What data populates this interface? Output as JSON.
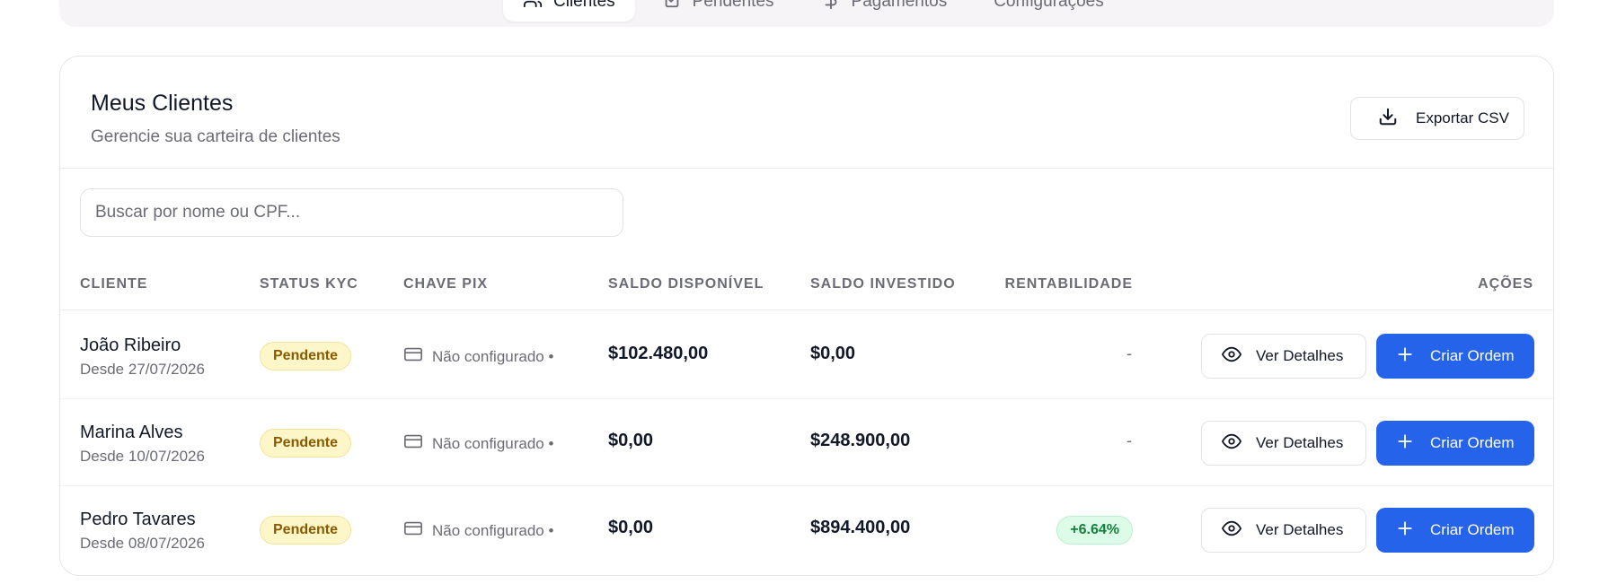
{
  "nav": {
    "tabs": [
      {
        "label": "Clientes",
        "icon": "users-icon",
        "active": true
      },
      {
        "label": "Pendentes",
        "icon": "clipboard-check-icon",
        "active": false
      },
      {
        "label": "Pagamentos",
        "icon": "dollar-icon",
        "active": false
      },
      {
        "label": "Configurações",
        "icon": "",
        "active": false
      }
    ]
  },
  "card": {
    "title": "Meus Clientes",
    "subtitle": "Gerencie sua carteira de clientes",
    "export_label": "Exportar CSV"
  },
  "search": {
    "placeholder": "Buscar por nome ou CPF...",
    "value": ""
  },
  "table": {
    "headers": {
      "cliente": "CLIENTE",
      "status_kyc": "STATUS KYC",
      "chave_pix": "CHAVE PIX",
      "saldo_disponivel": "SALDO DISPONÍVEL",
      "saldo_investido": "SALDO INVESTIDO",
      "rentabilidade": "RENTABILIDADE",
      "acoes": "AÇÕES"
    },
    "rows": [
      {
        "name": "João Ribeiro",
        "since": "Desde 27/07/2026",
        "kyc": "Pendente",
        "pix": "Não configurado •",
        "saldo_disponivel": "$102.480,00",
        "saldo_investido": "$0,00",
        "rentabilidade": "-",
        "details_label": "Ver Detalhes",
        "order_label": "Criar Ordem"
      },
      {
        "name": "Marina Alves",
        "since": "Desde 10/07/2026",
        "kyc": "Pendente",
        "pix": "Não configurado •",
        "saldo_disponivel": "$0,00",
        "saldo_investido": "$248.900,00",
        "rentabilidade": "-",
        "details_label": "Ver Detalhes",
        "order_label": "Criar Ordem"
      },
      {
        "name": "Pedro Tavares",
        "since": "Desde 08/07/2026",
        "kyc": "Pendente",
        "pix": "Não configurado •",
        "saldo_disponivel": "$0,00",
        "saldo_investido": "$894.400,00",
        "rentabilidade": "+6.64%",
        "details_label": "Ver Detalhes",
        "order_label": "Criar Ordem"
      }
    ]
  },
  "colors": {
    "primary": "#2563eb",
    "kyc_pending_bg": "#fdf6c8",
    "kyc_pending_text": "#8a5a00",
    "positive_bg": "#dcfce7",
    "positive_text": "#15803d"
  }
}
